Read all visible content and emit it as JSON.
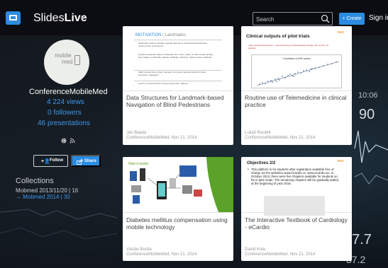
{
  "header": {
    "brand_prefix": "Slides",
    "brand_bold": "Live",
    "search_placeholder": "Search",
    "create_label": "+ Create",
    "signin_label": "Sign in"
  },
  "profile": {
    "avatar_line1": "mobile",
    "avatar_line2": "med",
    "name": "ConferenceMobileMed",
    "views": "4 224 views",
    "followers": "0 followers",
    "presentations": "46 presentations",
    "follow_label": "Follow",
    "share_label": "Share"
  },
  "collections": {
    "title": "Collections",
    "items": [
      {
        "label": "Mobmed 2013/11/20 | 16"
      },
      {
        "label": "→ Mobmed 2014 | 30"
      }
    ]
  },
  "cards": [
    {
      "title": "Data Structures for Landmark-based Navigation of Blind Pedestrians",
      "author": "Jan Balata",
      "meta": "ConferenceMobileMed, Nov 21, 2014",
      "slide": {
        "heading_a": "MOTIVATION",
        "heading_b": "| Landmarks",
        "lines": [
          "landmarks used by visually impaired depend on cultural and architectural context of the environment",
          "surfaces (material, shape of sidewalk, floor rises, shape of urban road), landing lines (edges of sidewalk, railings, buildings, vehicles), objects (poles, bollards)",
          "traffic sounds (busy street, tramway, car stops), acoustic (width of street, entrances, passages)",
          "scents of various kinds of stores (drug store, bakery)"
        ]
      }
    },
    {
      "title": "Routine use of Telemedicine in clinical practice",
      "author": "Lukáš Roubík",
      "meta": "ConferenceMobileMed, Nov 21, 2014",
      "slide": {
        "heading": "Clinical outputs of pilot trials",
        "logo": "n+c",
        "text": "major clinical achievement – telemonitoring of anticoagulation therapy, 30 months, 35 patients",
        "chart_title": "Correlation of INR values"
      }
    },
    {
      "title": "Diabetes mellitus compensation using mobile technology",
      "author": "Václav Burda",
      "meta": "ConferenceMobileMed, Nov 21, 2014",
      "slide": {
        "heading": "How it works"
      }
    },
    {
      "title": "The Interactive Textbook of Cardiology - eCardio",
      "author": "David Kula",
      "meta": "ConferenceMobileMed, Nov 21, 2014",
      "slide": {
        "heading": "Objectives 2/2",
        "logo": "n+c",
        "text": "This platform is for students after registration available free of charge via the websites www.eCardio.cz, www.eCardio.eu. In October 2014, there were five chapters available for students so far in pilot mode. The remaining chapters will be gradually added, at the beginning of year 2015."
      }
    }
  ],
  "background_numbers": [
    "10:06",
    "90",
    "37.7",
    "37.2"
  ],
  "colors": {
    "accent": "#2b8ce2",
    "link": "#3f97ea",
    "topbar": "#0a0c10"
  }
}
